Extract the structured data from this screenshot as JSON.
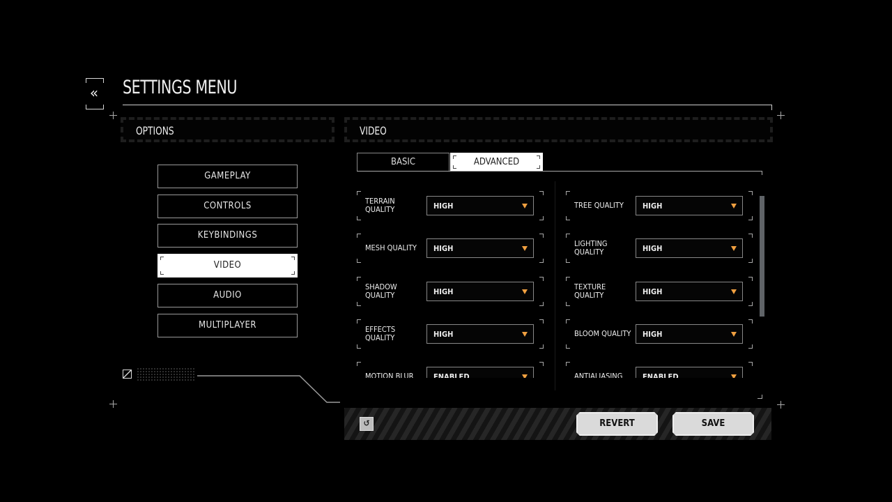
{
  "header": {
    "title": "SETTINGS MENU",
    "back_icon": "double-chevron-left-icon",
    "back_glyph": "«"
  },
  "options_panel": {
    "title": "OPTIONS",
    "items": [
      {
        "label": "GAMEPLAY",
        "active": false
      },
      {
        "label": "CONTROLS",
        "active": false
      },
      {
        "label": "KEYBINDINGS",
        "active": false
      },
      {
        "label": "VIDEO",
        "active": true
      },
      {
        "label": "AUDIO",
        "active": false
      },
      {
        "label": "MULTIPLAYER",
        "active": false
      }
    ]
  },
  "video_panel": {
    "title": "VIDEO",
    "tabs": [
      {
        "label": "BASIC",
        "active": false
      },
      {
        "label": "ADVANCED",
        "active": true
      }
    ],
    "left_settings": [
      {
        "label": "TERRAIN QUALITY",
        "value": "HIGH"
      },
      {
        "label": "MESH QUALITY",
        "value": "HIGH"
      },
      {
        "label": "SHADOW QUALITY",
        "value": "HIGH"
      },
      {
        "label": "EFFECTS QUALITY",
        "value": "HIGH"
      },
      {
        "label": "MOTION BLUR",
        "value": "ENABLED"
      }
    ],
    "right_settings": [
      {
        "label": "TREE QUALITY",
        "value": "HIGH"
      },
      {
        "label": "LIGHTING QUALITY",
        "value": "HIGH"
      },
      {
        "label": "TEXTURE QUALITY",
        "value": "HIGH"
      },
      {
        "label": "BLOOM QUALITY",
        "value": "HIGH"
      },
      {
        "label": "ANTIALIASING",
        "value": "ENABLED"
      }
    ]
  },
  "footer": {
    "reset_glyph": "↺",
    "revert_label": "REVERT",
    "save_label": "SAVE"
  },
  "colors": {
    "accent_arrow": "#f0a040",
    "scrollbar": "#5f6367",
    "active_bg": "#ffffff"
  }
}
